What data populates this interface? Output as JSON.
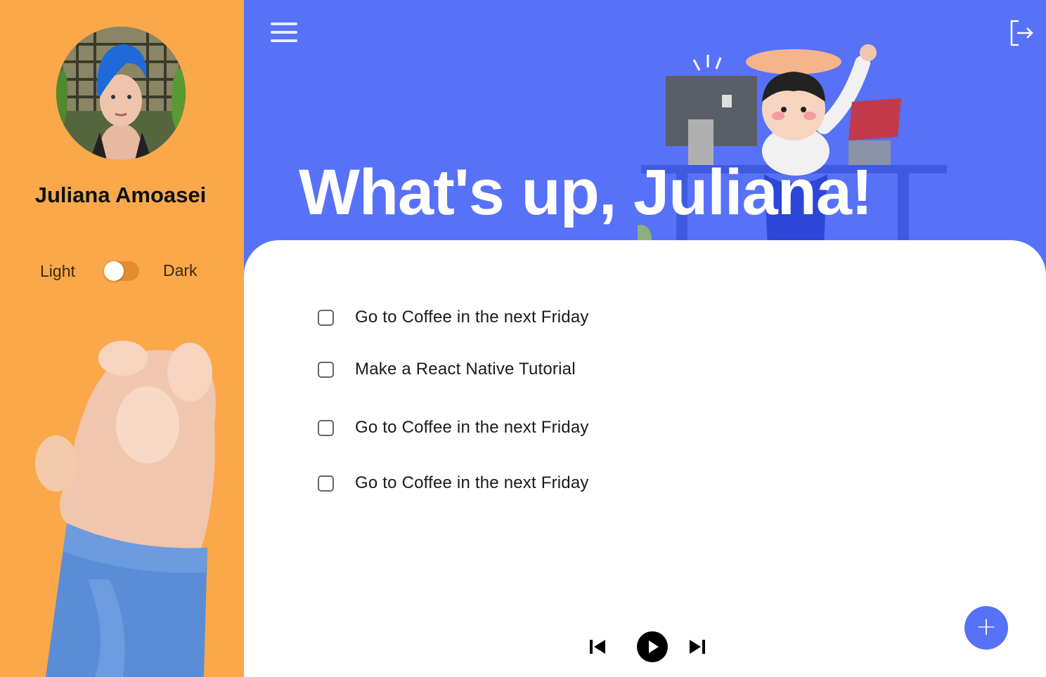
{
  "user": {
    "name": "Juliana Amoasei"
  },
  "theme": {
    "light_label": "Light",
    "dark_label": "Dark",
    "selected": "light"
  },
  "header": {
    "greeting": "What's up, Juliana!",
    "menu_icon": "hamburger-menu-icon",
    "logout_icon": "logout-icon"
  },
  "tasks": [
    {
      "label": "Go to Coffee in the next Friday",
      "checked": false
    },
    {
      "label": "Make a React Native Tutorial",
      "checked": false
    },
    {
      "label": "Go to Coffee in the next Friday",
      "checked": false
    },
    {
      "label": "Go to Coffee in the next Friday",
      "checked": false
    }
  ],
  "player": {
    "prev_icon": "skip-previous-icon",
    "play_icon": "play-icon",
    "next_icon": "skip-next-icon"
  },
  "fab": {
    "label": "+",
    "icon": "plus-icon"
  },
  "colors": {
    "sidebar": "#fba84a",
    "header": "#5771f8",
    "accent": "#5771f8"
  }
}
